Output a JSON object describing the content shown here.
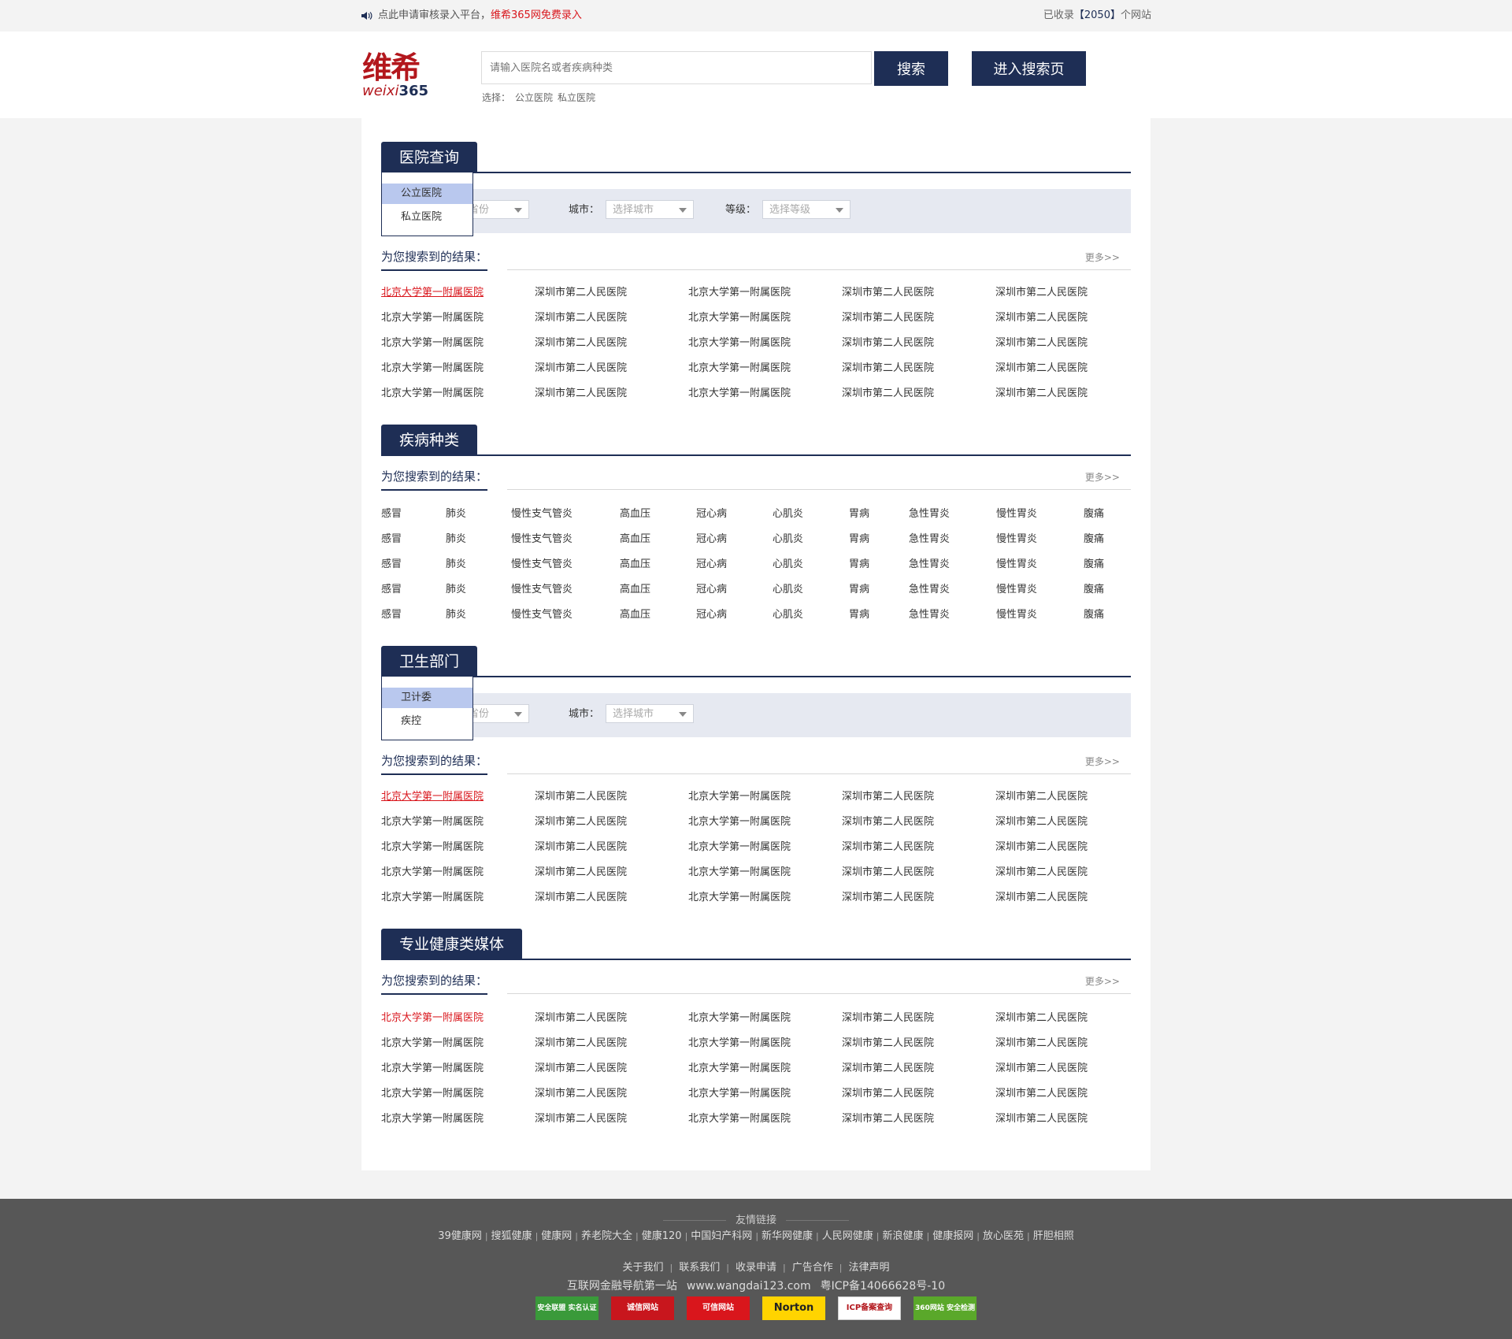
{
  "topbar": {
    "notice": "点此申请审核录入平台，",
    "notice_red": "维希365网免费录入",
    "collected_prefix": "已收录",
    "collected_count": "【2050】",
    "collected_suffix": "个网站"
  },
  "header": {
    "logo_cn": "维希",
    "logo_en": "weixi",
    "logo_num": "365",
    "search_placeholder": "请输入医院名或者疾病种类",
    "search_label": "搜索",
    "enter_label": "进入搜索页",
    "choose_label": "选择：",
    "choose_opts": [
      "公立医院",
      "私立医院"
    ]
  },
  "sections": {
    "hospital": {
      "title": "医院查询",
      "dropdown": [
        "公立医院",
        "私立医院"
      ],
      "province_placeholder": "省份",
      "city_label": "城市：",
      "city_placeholder": "选择城市",
      "level_label": "等级：",
      "level_placeholder": "选择等级",
      "result_label": "为您搜索到的结果：",
      "more": "更多>>",
      "rows": [
        [
          "北京大学第一附属医院",
          "深圳市第二人民医院",
          "北京大学第一附属医院",
          "深圳市第二人民医院",
          "深圳市第二人民医院"
        ],
        [
          "北京大学第一附属医院",
          "深圳市第二人民医院",
          "北京大学第一附属医院",
          "深圳市第二人民医院",
          "深圳市第二人民医院"
        ],
        [
          "北京大学第一附属医院",
          "深圳市第二人民医院",
          "北京大学第一附属医院",
          "深圳市第二人民医院",
          "深圳市第二人民医院"
        ],
        [
          "北京大学第一附属医院",
          "深圳市第二人民医院",
          "北京大学第一附属医院",
          "深圳市第二人民医院",
          "深圳市第二人民医院"
        ],
        [
          "北京大学第一附属医院",
          "深圳市第二人民医院",
          "北京大学第一附属医院",
          "深圳市第二人民医院",
          "深圳市第二人民医院"
        ]
      ]
    },
    "disease": {
      "title": "疾病种类",
      "result_label": "为您搜索到的结果：",
      "more": "更多>>",
      "rows": [
        [
          "感冒",
          "肺炎",
          "慢性支气管炎",
          "高血压",
          "冠心病",
          "心肌炎",
          "胃病",
          "急性胃炎",
          "慢性胃炎",
          "腹痛"
        ],
        [
          "感冒",
          "肺炎",
          "慢性支气管炎",
          "高血压",
          "冠心病",
          "心肌炎",
          "胃病",
          "急性胃炎",
          "慢性胃炎",
          "腹痛"
        ],
        [
          "感冒",
          "肺炎",
          "慢性支气管炎",
          "高血压",
          "冠心病",
          "心肌炎",
          "胃病",
          "急性胃炎",
          "慢性胃炎",
          "腹痛"
        ],
        [
          "感冒",
          "肺炎",
          "慢性支气管炎",
          "高血压",
          "冠心病",
          "心肌炎",
          "胃病",
          "急性胃炎",
          "慢性胃炎",
          "腹痛"
        ],
        [
          "感冒",
          "肺炎",
          "慢性支气管炎",
          "高血压",
          "冠心病",
          "心肌炎",
          "胃病",
          "急性胃炎",
          "慢性胃炎",
          "腹痛"
        ]
      ]
    },
    "health_dept": {
      "title": "卫生部门",
      "dropdown": [
        "卫计委",
        "疾控"
      ],
      "province_placeholder": "省份",
      "city_label": "城市：",
      "city_placeholder": "选择城市",
      "result_label": "为您搜索到的结果：",
      "more": "更多>>",
      "rows": [
        [
          "北京大学第一附属医院",
          "深圳市第二人民医院",
          "北京大学第一附属医院",
          "深圳市第二人民医院",
          "深圳市第二人民医院"
        ],
        [
          "北京大学第一附属医院",
          "深圳市第二人民医院",
          "北京大学第一附属医院",
          "深圳市第二人民医院",
          "深圳市第二人民医院"
        ],
        [
          "北京大学第一附属医院",
          "深圳市第二人民医院",
          "北京大学第一附属医院",
          "深圳市第二人民医院",
          "深圳市第二人民医院"
        ],
        [
          "北京大学第一附属医院",
          "深圳市第二人民医院",
          "北京大学第一附属医院",
          "深圳市第二人民医院",
          "深圳市第二人民医院"
        ],
        [
          "北京大学第一附属医院",
          "深圳市第二人民医院",
          "北京大学第一附属医院",
          "深圳市第二人民医院",
          "深圳市第二人民医院"
        ]
      ]
    },
    "media": {
      "title": "专业健康类媒体",
      "result_label": "为您搜索到的结果：",
      "more": "更多>>",
      "rows": [
        [
          "北京大学第一附属医院",
          "深圳市第二人民医院",
          "北京大学第一附属医院",
          "深圳市第二人民医院",
          "深圳市第二人民医院"
        ],
        [
          "北京大学第一附属医院",
          "深圳市第二人民医院",
          "北京大学第一附属医院",
          "深圳市第二人民医院",
          "深圳市第二人民医院"
        ],
        [
          "北京大学第一附属医院",
          "深圳市第二人民医院",
          "北京大学第一附属医院",
          "深圳市第二人民医院",
          "深圳市第二人民医院"
        ],
        [
          "北京大学第一附属医院",
          "深圳市第二人民医院",
          "北京大学第一附属医院",
          "深圳市第二人民医院",
          "深圳市第二人民医院"
        ],
        [
          "北京大学第一附属医院",
          "深圳市第二人民医院",
          "北京大学第一附属医院",
          "深圳市第二人民医院",
          "深圳市第二人民医院"
        ]
      ]
    }
  },
  "footer": {
    "friend_title": "友情链接",
    "friend_links": [
      "39健康网",
      "搜狐健康",
      "健康网",
      "养老院大全",
      "健康120",
      "中国妇产科网",
      "新华网健康",
      "人民网健康",
      "新浪健康",
      "健康报网",
      "放心医苑",
      "肝胆相照"
    ],
    "about_links": [
      "关于我们",
      "联系我们",
      "收录申请",
      "广告合作",
      "法律声明"
    ],
    "slogan": "互联网金融导航第一站",
    "domain": "www.wangdai123.com",
    "icp": "粤ICP备14066628号-10",
    "badges": [
      "安全联盟 实名认证",
      "诚信网站",
      "可信网站",
      "Norton",
      "ICP备案查询",
      "360网站 安全检测"
    ]
  },
  "colors": {
    "navy": "#1e2e55",
    "red": "#d9161c",
    "filter_bg": "#e6e9f1",
    "footer_bg": "#575757"
  }
}
